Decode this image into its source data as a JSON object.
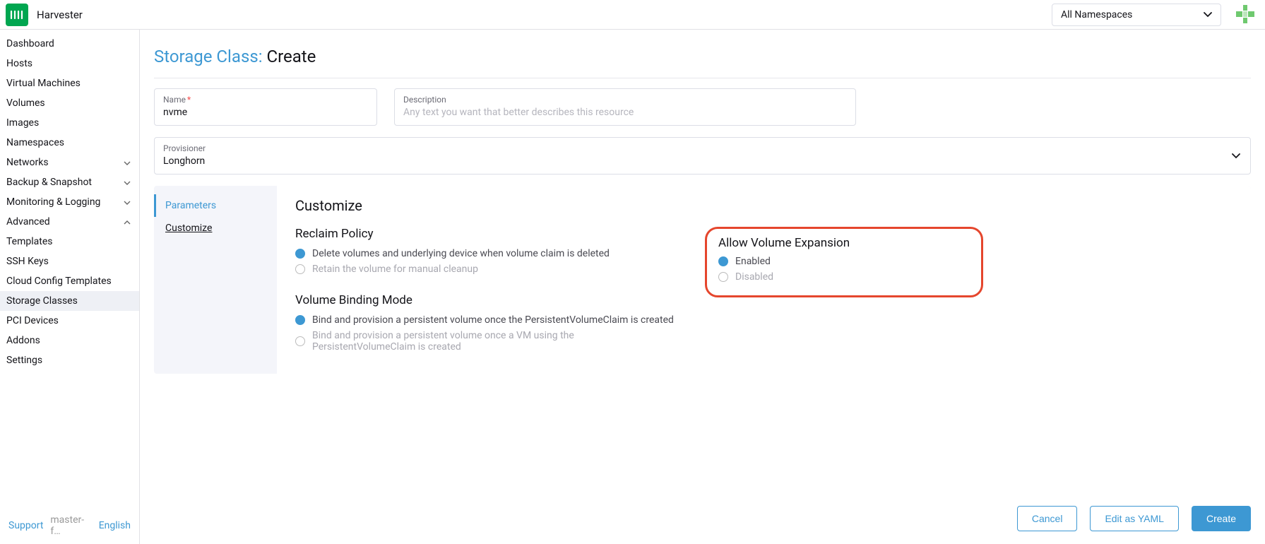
{
  "header": {
    "app_title": "Harvester",
    "namespace_value": "All Namespaces"
  },
  "sidebar": {
    "items": [
      {
        "label": "Dashboard",
        "expandable": false,
        "expanded": false
      },
      {
        "label": "Hosts",
        "expandable": false,
        "expanded": false
      },
      {
        "label": "Virtual Machines",
        "expandable": false,
        "expanded": false
      },
      {
        "label": "Volumes",
        "expandable": false,
        "expanded": false
      },
      {
        "label": "Images",
        "expandable": false,
        "expanded": false
      },
      {
        "label": "Namespaces",
        "expandable": false,
        "expanded": false
      },
      {
        "label": "Networks",
        "expandable": true,
        "expanded": false
      },
      {
        "label": "Backup & Snapshot",
        "expandable": true,
        "expanded": false
      },
      {
        "label": "Monitoring & Logging",
        "expandable": true,
        "expanded": false
      },
      {
        "label": "Advanced",
        "expandable": true,
        "expanded": true
      }
    ],
    "advanced_items": [
      {
        "label": "Templates"
      },
      {
        "label": "SSH Keys"
      },
      {
        "label": "Cloud Config Templates"
      },
      {
        "label": "Storage Classes",
        "active": true
      },
      {
        "label": "PCI Devices"
      },
      {
        "label": "Addons"
      },
      {
        "label": "Settings"
      }
    ],
    "footer": {
      "support": "Support",
      "version": "master-f…",
      "lang": "English"
    }
  },
  "main": {
    "title_crumb": "Storage Class:",
    "title_action": "Create",
    "name": {
      "label": "Name",
      "required": "*",
      "value": "nvme"
    },
    "description": {
      "label": "Description",
      "placeholder": "Any text you want that better describes this resource"
    },
    "provisioner": {
      "label": "Provisioner",
      "value": "Longhorn"
    },
    "tabs": [
      {
        "label": "Parameters",
        "selected": false,
        "highlight": true
      },
      {
        "label": "Customize",
        "selected": true,
        "highlight": false
      }
    ],
    "customize": {
      "heading": "Customize",
      "reclaim": {
        "heading": "Reclaim Policy",
        "opts": [
          {
            "label": "Delete volumes and underlying device when volume claim is deleted",
            "selected": true
          },
          {
            "label": "Retain the volume for manual cleanup",
            "selected": false
          }
        ]
      },
      "expansion": {
        "heading": "Allow Volume Expansion",
        "opts": [
          {
            "label": "Enabled",
            "selected": true
          },
          {
            "label": "Disabled",
            "selected": false
          }
        ]
      },
      "binding": {
        "heading": "Volume Binding Mode",
        "opts": [
          {
            "label": "Bind and provision a persistent volume once the PersistentVolumeClaim is created",
            "selected": true
          },
          {
            "label": "Bind and provision a persistent volume once a VM using the PersistentVolumeClaim is created",
            "selected": false
          }
        ]
      }
    },
    "actions": {
      "cancel": "Cancel",
      "edit_yaml": "Edit as YAML",
      "create": "Create"
    }
  }
}
